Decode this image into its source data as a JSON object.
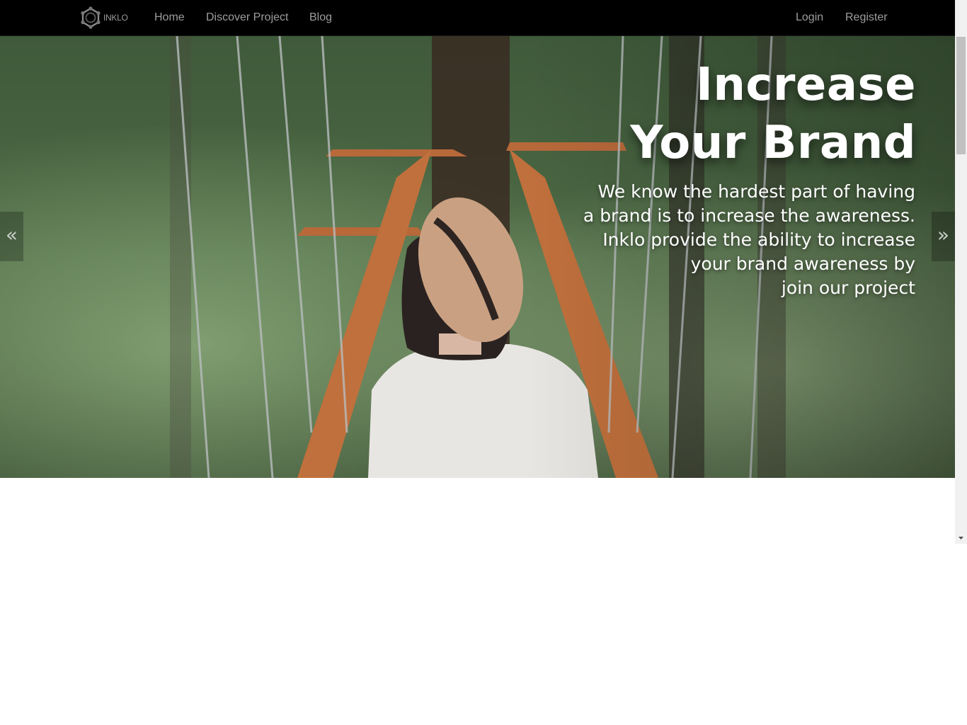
{
  "nav": {
    "brand_text": "INKLO",
    "home": "Home",
    "discover": "Discover Project",
    "blog": "Blog",
    "login": "Login",
    "register": "Register"
  },
  "hero": {
    "title_line1": "Increase",
    "title_line2": "Your Brand",
    "desc_line1": "We know the hardest part of having",
    "desc_line2": "a brand is to increase the awareness.",
    "desc_line3": "Inklo provide the ability to increase",
    "desc_line4": "your brand awareness by",
    "desc_line5": "join our project",
    "prev_glyph": "«",
    "next_glyph": "»"
  },
  "colors": {
    "navbar_bg": "#000000",
    "nav_link": "#9d9d9d",
    "hero_text": "#ffffff"
  }
}
